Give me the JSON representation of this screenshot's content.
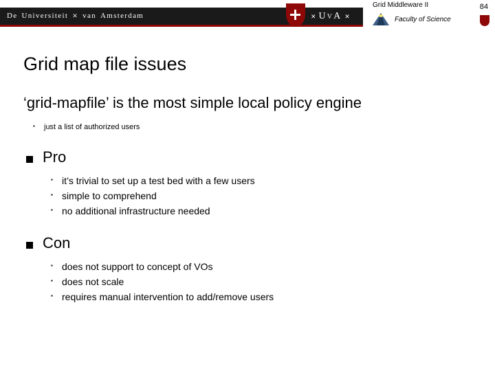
{
  "header": {
    "university_prefix": "De",
    "university_mid1": "Universiteit",
    "university_mid2": "van",
    "university_name": "Amsterdam",
    "uva_mono": "UvA",
    "course_title": "Grid Middleware II",
    "faculty_label": "Faculty of Science",
    "slide_number": "84"
  },
  "slide": {
    "title": "Grid map file issues",
    "subtitle": "‘grid-mapfile’ is the most simple local policy engine",
    "intro_items": [
      "just a list of authorized users"
    ],
    "sections": [
      {
        "heading": "Pro",
        "items": [
          "it’s trivial to set up a test bed with a few users",
          "simple to comprehend",
          "no additional infrastructure needed"
        ]
      },
      {
        "heading": "Con",
        "items": [
          "does not support to concept of VOs",
          "does not scale",
          "requires manual intervention to add/remove users"
        ]
      }
    ]
  }
}
